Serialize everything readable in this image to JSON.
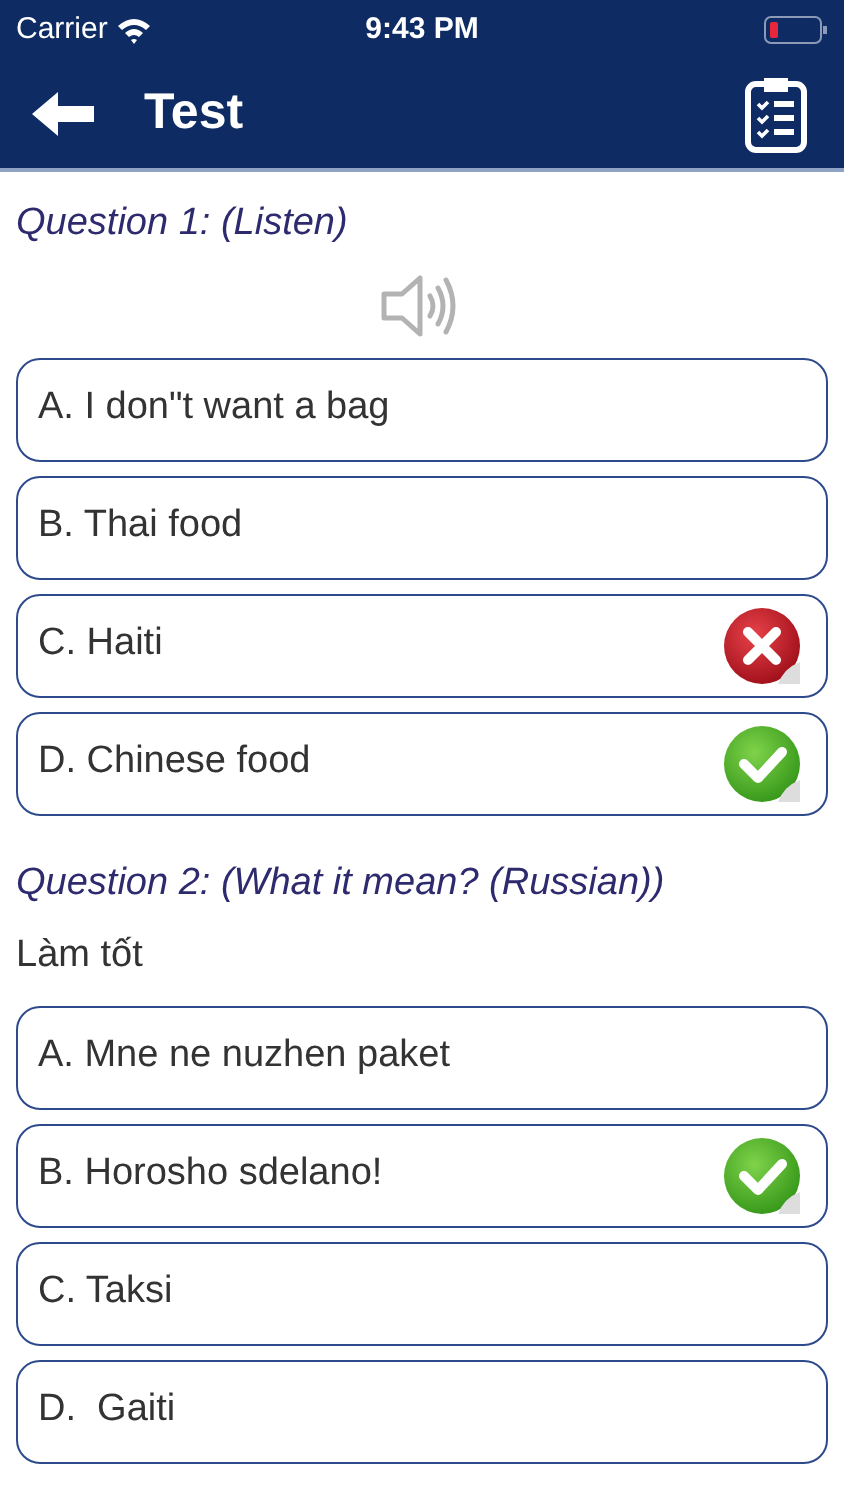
{
  "status_bar": {
    "carrier": "Carrier",
    "time": "9:43 PM"
  },
  "header": {
    "title": "Test"
  },
  "questions": [
    {
      "title": "Question 1: (Listen)",
      "kind": "listen",
      "options": [
        {
          "label": "A. I don\"t want a bag",
          "wrong": false,
          "right": false
        },
        {
          "label": "B. Thai food",
          "wrong": false,
          "right": false
        },
        {
          "label": "C. Haiti",
          "wrong": true,
          "right": false
        },
        {
          "label": "D. Chinese food",
          "wrong": false,
          "right": true
        }
      ]
    },
    {
      "title": "Question 2: (What it mean? (Russian))",
      "kind": "text",
      "prompt": "Làm tốt",
      "options": [
        {
          "label": "A. Mne ne nuzhen paket",
          "wrong": false,
          "right": false
        },
        {
          "label": "B. Horosho sdelano!",
          "wrong": false,
          "right": true
        },
        {
          "label": "C. Taksi",
          "wrong": false,
          "right": false
        },
        {
          "label": "D.  Gaiti",
          "wrong": false,
          "right": false
        }
      ]
    }
  ]
}
